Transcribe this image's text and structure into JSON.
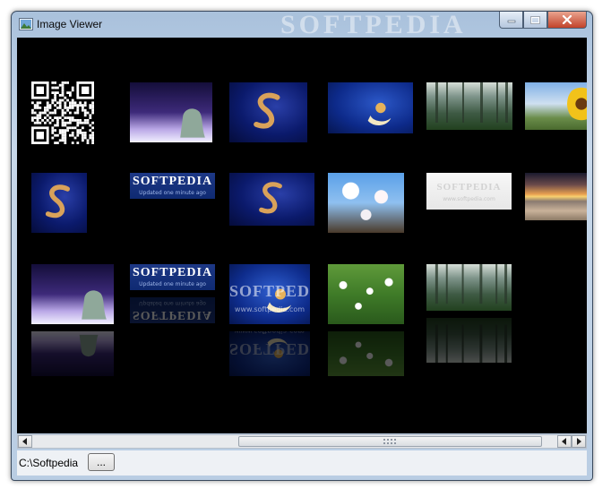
{
  "window": {
    "title": "Image Viewer",
    "watermark": "SOFTPEDIA",
    "app_icon": "image-viewer-icon",
    "buttons": [
      "minimize-icon",
      "maximize-icon",
      "close-icon"
    ]
  },
  "gallery": {
    "thumbnails": [
      {
        "name": "qr-code",
        "kind": "qr"
      },
      {
        "name": "purple-sphinx-wallpaper",
        "kind": "sphinx"
      },
      {
        "name": "blue-s-logo-wallpaper",
        "kind": "blue-s"
      },
      {
        "name": "moon-angel-wallpaper",
        "kind": "moon"
      },
      {
        "name": "misty-forest",
        "kind": "forest"
      },
      {
        "name": "sunflower-road",
        "kind": "sunflower"
      },
      {
        "name": "blue-s-logo-portrait",
        "kind": "blue-s-tall"
      },
      {
        "name": "softpedia-banner",
        "kind": "softpedia",
        "text": "SOFTPEDIA",
        "subtext": "Updated one minute ago"
      },
      {
        "name": "blue-s-logo-dark",
        "kind": "blue-s"
      },
      {
        "name": "white-blossoms",
        "kind": "blossom"
      },
      {
        "name": "softpedia-light-banner",
        "kind": "softpedia-light",
        "text": "SOFTPEDIA",
        "subtext": "www.softpedia.com"
      },
      {
        "name": "sunset-beach",
        "kind": "sunset"
      },
      {
        "name": "purple-sphinx-wallpaper-2",
        "kind": "sphinx"
      },
      {
        "name": "softpedia-banner-2",
        "kind": "softpedia",
        "text": "SOFTPEDIA",
        "subtext": "Updated one minute ago"
      },
      {
        "name": "moon-angel-softpedia",
        "kind": "moon-watermark",
        "text": "SOFTPEDIA",
        "subtext": "www.softpedia.com"
      },
      {
        "name": "daisy-meadow",
        "kind": "daisies"
      },
      {
        "name": "misty-forest-2",
        "kind": "forest"
      }
    ]
  },
  "scrollbar": {
    "left_icon": "scroll-left-icon",
    "right_icon": "scroll-right-icon",
    "position": 0.46
  },
  "status": {
    "path": "C:\\Softpedia",
    "browse_label": "..."
  },
  "colors": {
    "canvas": "#000000",
    "frame": "#b9cde3",
    "close": "#c2432a"
  }
}
